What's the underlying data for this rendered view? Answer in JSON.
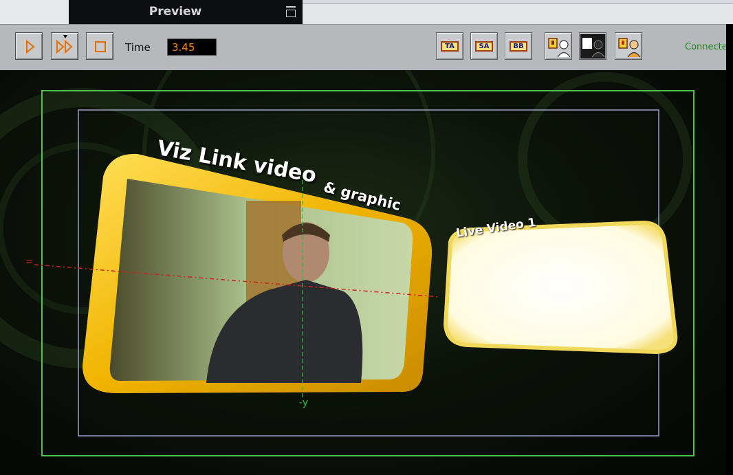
{
  "window": {
    "title": "Preview"
  },
  "toolbar": {
    "play_icon": "play-icon",
    "continue_icon": "continue-icon",
    "stop_icon": "stop-icon",
    "time_label": "Time",
    "time_value": "3.45",
    "layer_buttons": [
      {
        "label": "TA"
      },
      {
        "label": "SA"
      },
      {
        "label": "BB"
      }
    ],
    "status": "Connected"
  },
  "scene": {
    "headline_line1": "Viz Link video",
    "headline_line2": "& graphic",
    "live_label": "Live Video 1",
    "axis_label": "-y",
    "marker_label": "="
  },
  "colors": {
    "accent_orange": "#ff8a00",
    "frame_yellow": "#f1c400",
    "safe_area": "#4fc24f",
    "title_area": "#9aa0c8",
    "status_green": "#1a8a1a"
  }
}
